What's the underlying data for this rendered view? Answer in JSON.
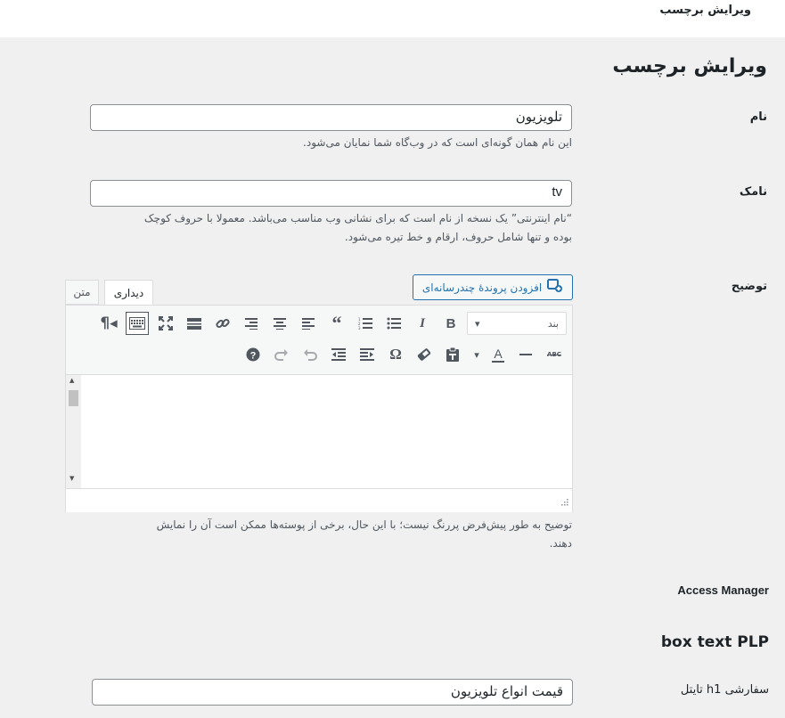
{
  "topbar": {
    "title": "ویرایش برچسب"
  },
  "page": {
    "heading": "ویرایش برچسب"
  },
  "name_field": {
    "label": "نام",
    "value": "تلویزیون",
    "description": "این نام همان گونه‌ای است که در وب‌گاه شما نمایان می‌شود."
  },
  "slug_field": {
    "label": "نامک",
    "value": "tv",
    "description_line1": "“نام اینترنتی” یک نسخه از نام است که برای نشانی وب مناسب می‌باشد. معمولا با حروف کوچک",
    "description_line2": "بوده و تنها شامل حروف، ارقام و خط تیره می‌شود."
  },
  "description_field": {
    "label": "توضیح",
    "add_media_label": "افزودن پروندهٔ چندرسانه‌ای",
    "tab_visual": "دیداری",
    "tab_text": "متن",
    "format_select": "بند",
    "help_line1": "توضیح به طور پیش‌فرض پررنگ نیست؛ با این حال، برخی از پوسته‌ها ممکن است آن را نمایش",
    "help_line2": "دهند."
  },
  "access_manager": {
    "label": "Access Manager"
  },
  "box_text": {
    "title": "box text PLP"
  },
  "custom_h1": {
    "label": "تایتل h1 سفارشی",
    "value": "قیمت انواع تلویزیون"
  }
}
